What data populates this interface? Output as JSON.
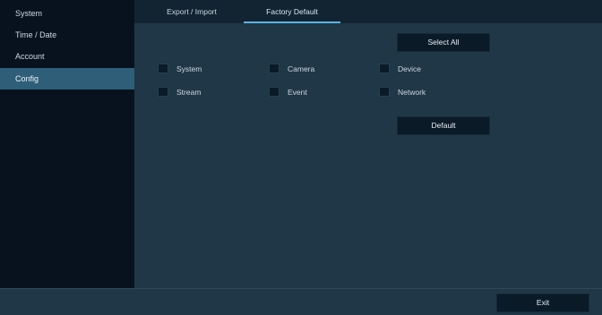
{
  "sidebar": {
    "items": [
      {
        "label": "System"
      },
      {
        "label": "Time / Date"
      },
      {
        "label": "Account"
      },
      {
        "label": "Config"
      }
    ],
    "active": "Config"
  },
  "tabs": [
    {
      "label": "Export / Import"
    },
    {
      "label": "Factory Default"
    }
  ],
  "active_tab": "Factory Default",
  "buttons": {
    "select_all": "Select All",
    "default": "Default",
    "exit": "Exit"
  },
  "checkboxes": [
    {
      "label": "System",
      "checked": false
    },
    {
      "label": "Camera",
      "checked": false
    },
    {
      "label": "Device",
      "checked": false
    },
    {
      "label": "Stream",
      "checked": false
    },
    {
      "label": "Event",
      "checked": false
    },
    {
      "label": "Network",
      "checked": false
    }
  ],
  "colors": {
    "accent": "#5bb2e4",
    "sidebar_active": "#2f5e79",
    "panel": "#1f3747",
    "button": "#0b1a27"
  }
}
